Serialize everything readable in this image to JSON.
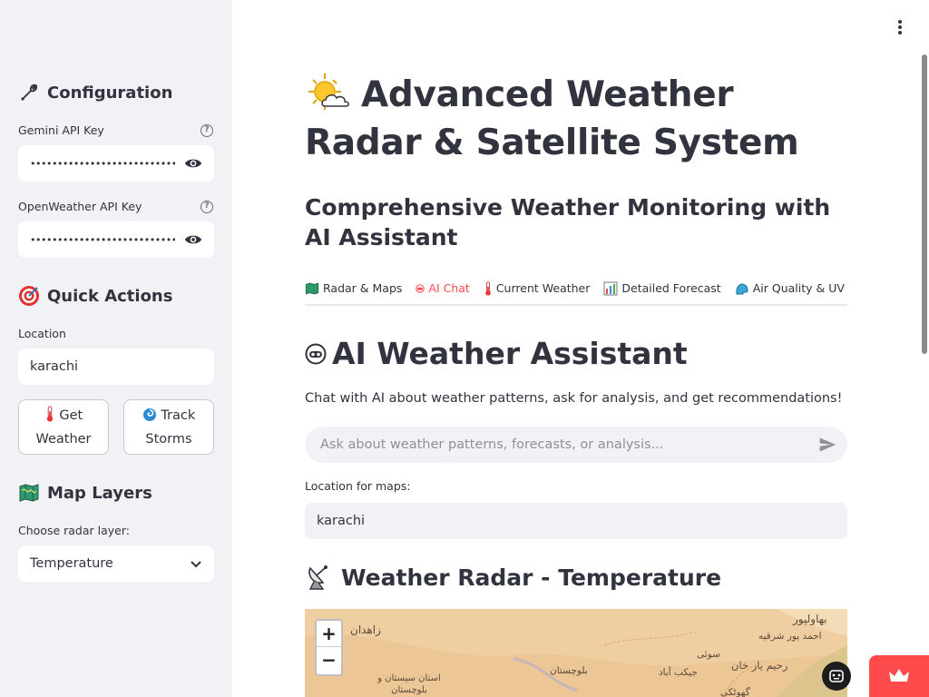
{
  "sidebar": {
    "configuration_heading": "Configuration",
    "gemini_label": "Gemini API Key",
    "gemini_value": "•••••••••••••••••••••••••••••",
    "openweather_label": "OpenWeather API Key",
    "openweather_value": "•••••••••••••••••••••••••••••",
    "quick_actions_heading": "Quick Actions",
    "location_label": "Location",
    "location_value": "karachi",
    "get_weather_button": "Get Weather",
    "track_storms_button": "Track Storms",
    "map_layers_heading": "Map Layers",
    "radar_layer_label": "Choose radar layer:",
    "radar_layer_value": "Temperature"
  },
  "main": {
    "title": "Advanced Weather Radar & Satellite System",
    "subtitle": "Comprehensive Weather Monitoring with AI Assistant",
    "tabs": [
      {
        "label": "Radar & Maps",
        "icon": "map-icon"
      },
      {
        "label": "AI Chat",
        "icon": "robot-icon",
        "active": true
      },
      {
        "label": "Current Weather",
        "icon": "thermometer-icon"
      },
      {
        "label": "Detailed Forecast",
        "icon": "bar-chart-icon"
      },
      {
        "label": "Air Quality & UV",
        "icon": "wind-face-icon"
      }
    ],
    "assistant_heading": "AI Weather Assistant",
    "assistant_description": "Chat with AI about weather patterns, ask for analysis, and get recommendations!",
    "chat_placeholder": "Ask about weather patterns, forecasts, or analysis...",
    "location_for_maps_label": "Location for maps:",
    "location_for_maps_value": "karachi",
    "radar_heading": "Weather Radar - Temperature",
    "map": {
      "zoom_in": "+",
      "zoom_out": "−",
      "labels": [
        "زاهدان",
        "بهاولپور",
        "احمد پور شرقیه",
        "سوئی",
        "رحیم یار خان",
        "جیکب آباد",
        "بلوچستان",
        "استان سیستان و بلوچستان",
        "گھوٹکی"
      ]
    }
  },
  "colors": {
    "accent": "#ff4b4b",
    "sidebar_bg": "#f0f2f6",
    "text": "#31333f",
    "map_bg": "#ecc899"
  }
}
